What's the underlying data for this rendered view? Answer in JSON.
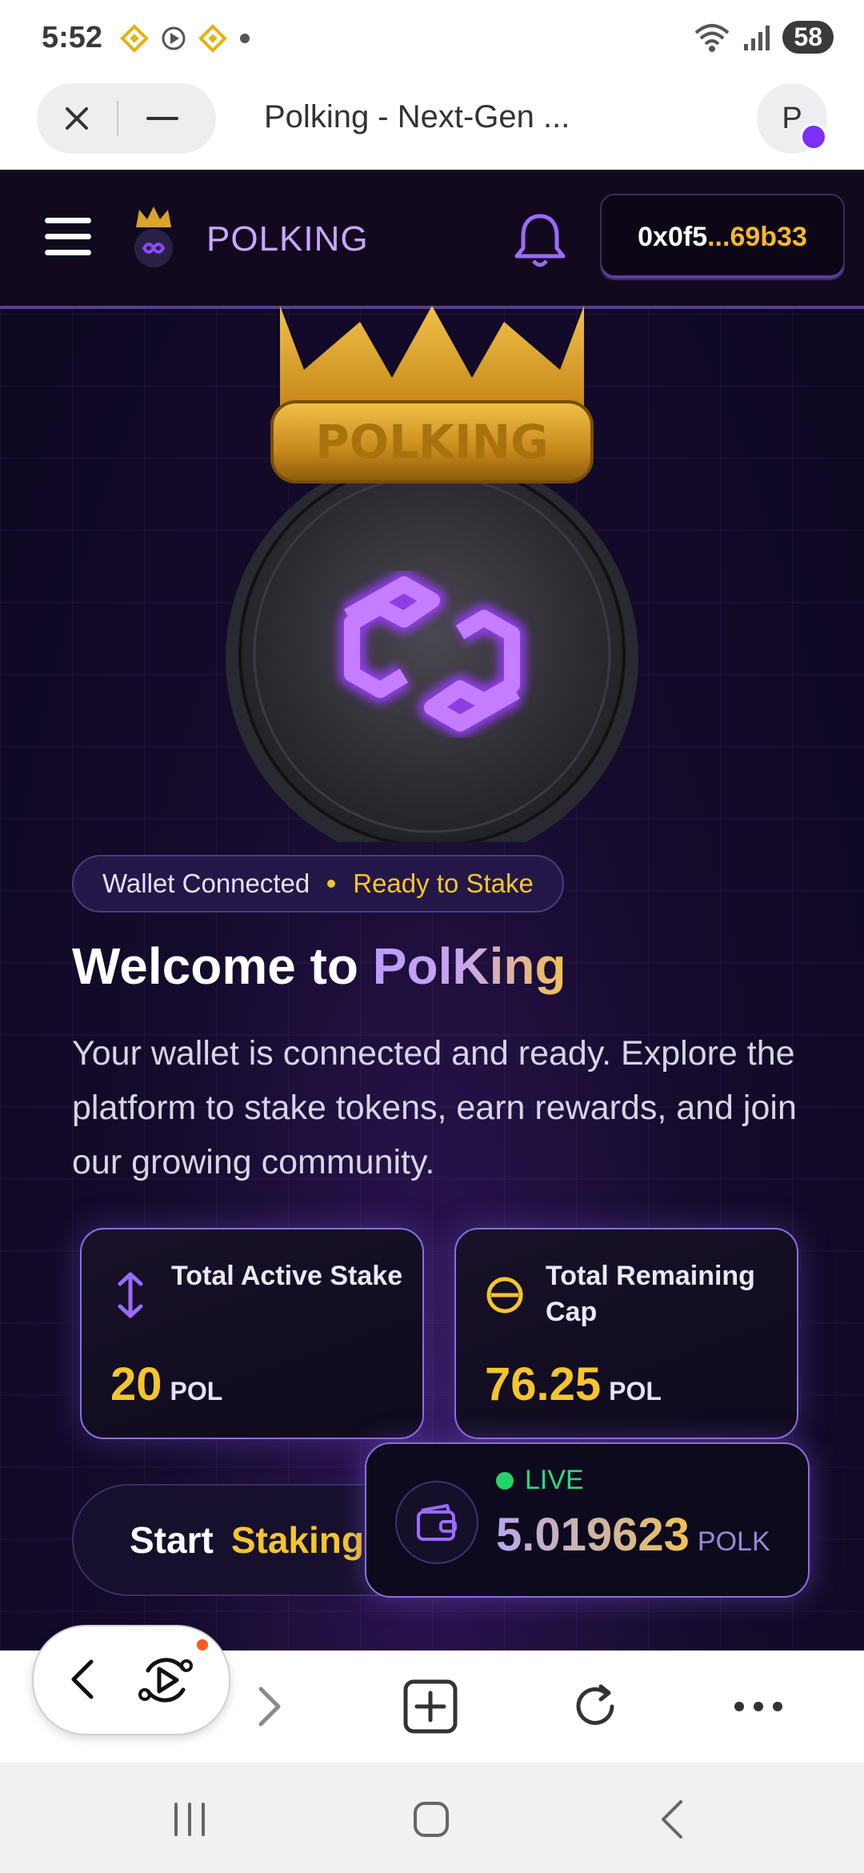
{
  "status_bar": {
    "time": "5:52",
    "battery": "58",
    "icons_left": [
      "binance-icon",
      "sync-play-icon",
      "binance-icon",
      "dot-icon"
    ],
    "icons_right": [
      "wifi-icon",
      "signal-icon",
      "battery-icon"
    ]
  },
  "browser": {
    "tab_title": "Polking - Next-Gen ...",
    "profile_initial": "P"
  },
  "app": {
    "brand": "POLKING",
    "wallet": {
      "prefix": "0x0f5",
      "suffix": "...69b33"
    },
    "hero_crown_text": "POLKING",
    "status": {
      "connected": "Wallet Connected",
      "ready": "Ready to Stake"
    },
    "welcome": {
      "prefix": "Welcome to ",
      "accent": "PolKing"
    },
    "description": "Your wallet is connected and ready. Explore the platform to stake tokens, earn rewards, and join our growing community.",
    "stats": [
      {
        "label": "Total Active Stake",
        "value": "20",
        "unit": "POL"
      },
      {
        "label": "Total Remaining Cap",
        "value": "76.25",
        "unit": "POL"
      }
    ],
    "start_button": {
      "word1": "Start",
      "word2": "Staking"
    },
    "live": {
      "tag": "LIVE",
      "value": "5.019623",
      "unit": "POLK"
    }
  },
  "colors": {
    "accent_purple": "#8a5cf6",
    "gold": "#f5c52e",
    "live_green": "#24d468",
    "background": "#150b2c"
  }
}
